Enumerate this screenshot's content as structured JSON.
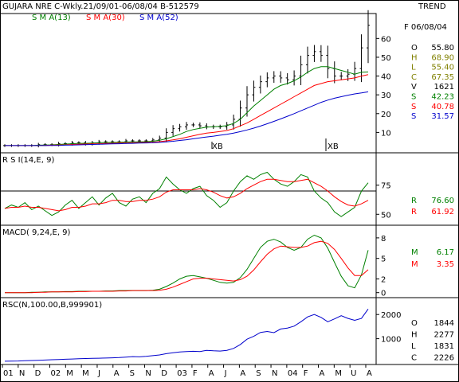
{
  "header": {
    "title": "GUJARA NRE C-Wkly.21/09/01-06/08/04  B-512579",
    "trend": "TREND",
    "date": "F 06/08/04",
    "sma13": "S M A(13)",
    "sma30": "S M A(30)",
    "sma52": "S M A(52)"
  },
  "colors": {
    "price": "#000000",
    "sma13": "#008000",
    "sma30": "#ff0000",
    "sma52": "#0000cc",
    "rsi": "#008000",
    "rsi_avg": "#ff0000",
    "macd": "#008000",
    "signal": "#ff0000",
    "rsc": "#0000cc",
    "o_label": "#000000",
    "h_label": "#808000",
    "l_label": "#808000",
    "c_label": "#808000",
    "v_label": "#000000"
  },
  "price_panel": {
    "readout": [
      {
        "key": "O",
        "value": "55.80",
        "color": "#000000"
      },
      {
        "key": "H",
        "value": "68.90",
        "color": "#808000"
      },
      {
        "key": "L",
        "value": "55.40",
        "color": "#808000"
      },
      {
        "key": "C",
        "value": "67.35",
        "color": "#808000"
      },
      {
        "key": "V",
        "value": "1621",
        "color": "#000000"
      },
      {
        "key": "S",
        "value": "42.23",
        "color": "#008000"
      },
      {
        "key": "S",
        "value": "40.78",
        "color": "#ff0000"
      },
      {
        "key": "S",
        "value": "31.57",
        "color": "#0000cc"
      }
    ],
    "markers": [
      "XB",
      "XB"
    ]
  },
  "rsi_panel": {
    "title": "R S I(14,E, 9)",
    "readout": [
      {
        "key": "R",
        "value": "76.60",
        "color": "#008000"
      },
      {
        "key": "R",
        "value": "61.92",
        "color": "#ff0000"
      }
    ]
  },
  "macd_panel": {
    "title": "MACD( 9,24,E, 9)",
    "readout": [
      {
        "key": "M",
        "value": "6.17",
        "color": "#008000"
      },
      {
        "key": "M",
        "value": "3.35",
        "color": "#ff0000"
      }
    ]
  },
  "rsc_panel": {
    "title": "RSC(N,100.00,B,999901)",
    "readout": [
      {
        "key": "O",
        "value": "1844",
        "color": "#000000"
      },
      {
        "key": "H",
        "value": "2277",
        "color": "#000000"
      },
      {
        "key": "L",
        "value": "1831",
        "color": "#000000"
      },
      {
        "key": "C",
        "value": "2226",
        "color": "#000000"
      }
    ]
  },
  "chart_data": [
    {
      "type": "line",
      "title": "GUJARA NRE C-Wkly.21/09/01-06/08/04  B-512579",
      "x_ticks": [
        "01",
        "N",
        "D",
        "02",
        "M",
        "M",
        "J",
        "A",
        "S",
        "N",
        "D",
        "03",
        "F",
        "A",
        "J",
        "A",
        "S",
        "N",
        "04",
        "F",
        "A",
        "M",
        "U",
        "A"
      ],
      "ylim": [
        0,
        72
      ],
      "yticks": [
        10,
        20,
        30,
        40,
        50,
        60
      ],
      "series": [
        {
          "name": "Price (weekly OHLC)",
          "values": [
            3,
            3,
            3,
            3,
            3,
            3.5,
            3.5,
            3.5,
            4,
            4,
            4.5,
            4.5,
            4,
            4.5,
            5,
            5,
            5,
            5,
            5.5,
            5.5,
            5.5,
            5.5,
            6,
            7,
            10,
            12,
            13,
            14,
            14,
            13.5,
            13,
            13,
            13,
            14,
            17,
            23,
            30,
            34,
            37,
            39,
            40,
            39,
            38,
            40,
            46,
            51,
            53,
            51,
            44,
            40,
            40,
            41,
            44,
            55,
            67
          ]
        },
        {
          "name": "S M A(13)",
          "values": [
            3,
            3,
            3,
            3,
            3,
            3.2,
            3.3,
            3.4,
            3.6,
            3.8,
            4,
            4.2,
            4.2,
            4.3,
            4.5,
            4.6,
            4.7,
            4.8,
            4.9,
            5,
            5,
            5.1,
            5.3,
            5.8,
            6.6,
            7.8,
            9,
            10.5,
            11.5,
            12.2,
            12.8,
            13,
            13.2,
            13.6,
            14.8,
            17,
            20.5,
            24,
            27,
            30,
            33,
            35,
            36,
            37.5,
            39.5,
            42,
            44,
            45,
            45,
            44,
            43,
            42,
            41,
            42,
            42.2
          ]
        },
        {
          "name": "S M A(30)",
          "values": [
            3,
            3,
            3,
            3,
            3,
            3,
            3.1,
            3.2,
            3.3,
            3.4,
            3.6,
            3.7,
            3.8,
            3.9,
            4,
            4.1,
            4.2,
            4.3,
            4.4,
            4.5,
            4.6,
            4.7,
            4.8,
            5.1,
            5.5,
            6,
            6.6,
            7.4,
            8.2,
            9,
            9.6,
            10,
            10.5,
            11,
            12,
            13.5,
            15,
            17,
            19,
            21,
            23,
            25,
            27,
            29,
            31,
            33,
            35,
            36,
            37,
            37.5,
            38,
            38.5,
            39,
            40,
            40.8
          ]
        },
        {
          "name": "S M A(52)",
          "values": [
            3,
            3,
            3,
            3,
            3,
            3,
            3,
            3.1,
            3.1,
            3.2,
            3.3,
            3.4,
            3.5,
            3.6,
            3.7,
            3.8,
            3.9,
            4,
            4.1,
            4.2,
            4.3,
            4.4,
            4.5,
            4.7,
            5,
            5.3,
            5.7,
            6.1,
            6.6,
            7.1,
            7.6,
            8,
            8.5,
            9,
            9.6,
            10.4,
            11.3,
            12.3,
            13.4,
            14.6,
            15.9,
            17.2,
            18.6,
            20,
            21.5,
            23,
            24.5,
            26,
            27.2,
            28.2,
            29,
            29.8,
            30.5,
            31,
            31.6
          ]
        }
      ]
    },
    {
      "type": "line",
      "title": "R S I(14,E, 9)",
      "ylim": [
        42,
        100
      ],
      "yticks": [
        50,
        75
      ],
      "reference_line": 70,
      "series": [
        {
          "name": "R S I",
          "values": [
            55,
            58,
            56,
            60,
            54,
            57,
            53,
            49,
            52,
            58,
            62,
            55,
            60,
            65,
            58,
            64,
            68,
            60,
            57,
            63,
            65,
            60,
            68,
            72,
            82,
            76,
            71,
            68,
            72,
            74,
            66,
            62,
            56,
            60,
            70,
            78,
            83,
            80,
            84,
            86,
            80,
            76,
            74,
            78,
            84,
            82,
            70,
            64,
            60,
            52,
            48,
            52,
            56,
            70,
            77
          ]
        },
        {
          "name": "R S I avg",
          "values": [
            55,
            56,
            56,
            57,
            56,
            56,
            55,
            54,
            53,
            54,
            56,
            56,
            57,
            59,
            59,
            60,
            62,
            62,
            61,
            61,
            62,
            62,
            63,
            65,
            69,
            71,
            71,
            71,
            71,
            72,
            71,
            69,
            66,
            64,
            65,
            68,
            72,
            75,
            78,
            80,
            80,
            79,
            78,
            78,
            79,
            80,
            77,
            74,
            70,
            65,
            61,
            58,
            57,
            59,
            62
          ]
        }
      ]
    },
    {
      "type": "line",
      "title": "MACD( 9,24,E, 9)",
      "ylim": [
        -0.5,
        9.5
      ],
      "yticks": [
        0,
        2,
        5,
        8
      ],
      "series": [
        {
          "name": "MACD",
          "values": [
            0,
            0,
            0,
            0,
            0.05,
            0.05,
            0.1,
            0.1,
            0.1,
            0.15,
            0.15,
            0.2,
            0.2,
            0.2,
            0.2,
            0.25,
            0.25,
            0.3,
            0.3,
            0.3,
            0.3,
            0.3,
            0.35,
            0.5,
            0.9,
            1.4,
            2,
            2.4,
            2.5,
            2.3,
            2.1,
            1.8,
            1.5,
            1.4,
            1.5,
            2.2,
            3.4,
            5,
            6.6,
            7.5,
            7.8,
            7.4,
            6.6,
            6.2,
            6.6,
            7.8,
            8.4,
            8,
            6.5,
            4.4,
            2.4,
            1,
            0.7,
            2.6,
            6.2
          ]
        },
        {
          "name": "Signal",
          "values": [
            0,
            0,
            0,
            0,
            0,
            0.05,
            0.05,
            0.1,
            0.1,
            0.1,
            0.1,
            0.15,
            0.15,
            0.2,
            0.2,
            0.2,
            0.2,
            0.25,
            0.25,
            0.3,
            0.3,
            0.3,
            0.3,
            0.35,
            0.5,
            0.8,
            1.2,
            1.6,
            2,
            2.1,
            2.1,
            2,
            1.9,
            1.8,
            1.7,
            1.9,
            2.4,
            3.3,
            4.5,
            5.6,
            6.4,
            6.8,
            6.7,
            6.6,
            6.6,
            6.8,
            7.3,
            7.5,
            7.2,
            6.3,
            5,
            3.6,
            2.5,
            2.5,
            3.35
          ]
        }
      ]
    },
    {
      "type": "line",
      "title": "RSC(N,100.00,B,999901)",
      "ylim": [
        0,
        2500
      ],
      "yticks": [
        1000,
        2000
      ],
      "series": [
        {
          "name": "RSC",
          "values": [
            70,
            75,
            80,
            90,
            100,
            110,
            120,
            130,
            140,
            150,
            160,
            170,
            180,
            190,
            195,
            200,
            210,
            220,
            240,
            260,
            250,
            270,
            300,
            330,
            380,
            420,
            450,
            470,
            480,
            470,
            520,
            500,
            490,
            520,
            600,
            760,
            980,
            1100,
            1260,
            1300,
            1250,
            1400,
            1440,
            1520,
            1700,
            1900,
            2000,
            1880,
            1700,
            1820,
            1950,
            1840,
            1760,
            1840,
            2226
          ]
        }
      ]
    }
  ]
}
